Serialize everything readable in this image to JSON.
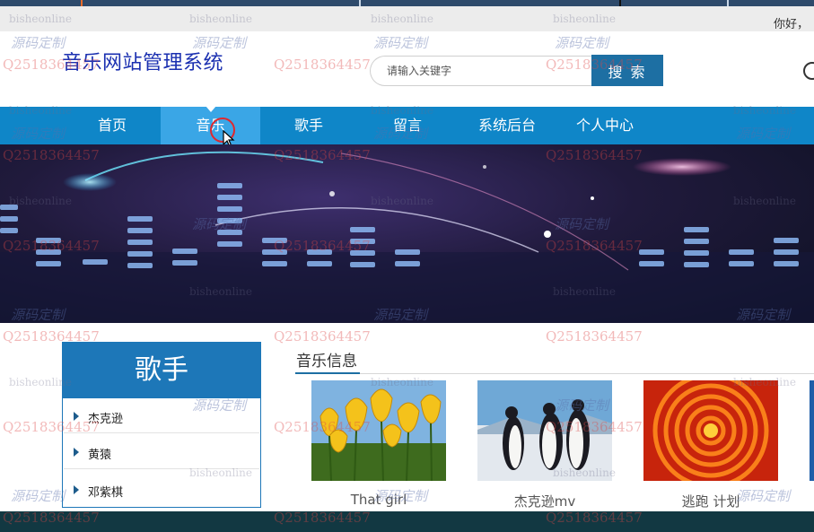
{
  "topbar": {
    "greeting": "你好，"
  },
  "header": {
    "site_title": "音乐网站管理系统",
    "search_placeholder": "请输入关键字",
    "search_button": "搜 索"
  },
  "nav": {
    "items": [
      {
        "label": "首页"
      },
      {
        "label": "音乐"
      },
      {
        "label": "歌手"
      },
      {
        "label": "留言"
      },
      {
        "label": "系统后台"
      },
      {
        "label": "个人中心"
      }
    ],
    "active_index": 1
  },
  "sidebar": {
    "title": "歌手",
    "singers": [
      {
        "name": "杰克逊"
      },
      {
        "name": "黄猿"
      },
      {
        "name": "邓紫棋"
      }
    ]
  },
  "main": {
    "section_title": "音乐信息",
    "cards": [
      {
        "caption": "That girl",
        "image": "yellow-tulips"
      },
      {
        "caption": "杰克逊mv",
        "image": "penguins"
      },
      {
        "caption": "逃跑 计划",
        "image": "red-chrysanthemum"
      }
    ]
  },
  "watermark": {
    "line1": "bisheonline",
    "line2": "源码定制",
    "line3": "Q2518364457"
  },
  "colors": {
    "nav_bg": "#0f86c8",
    "nav_active": "#3aa6e6",
    "accent": "#1d6fa3",
    "title": "#1a2fb0"
  }
}
